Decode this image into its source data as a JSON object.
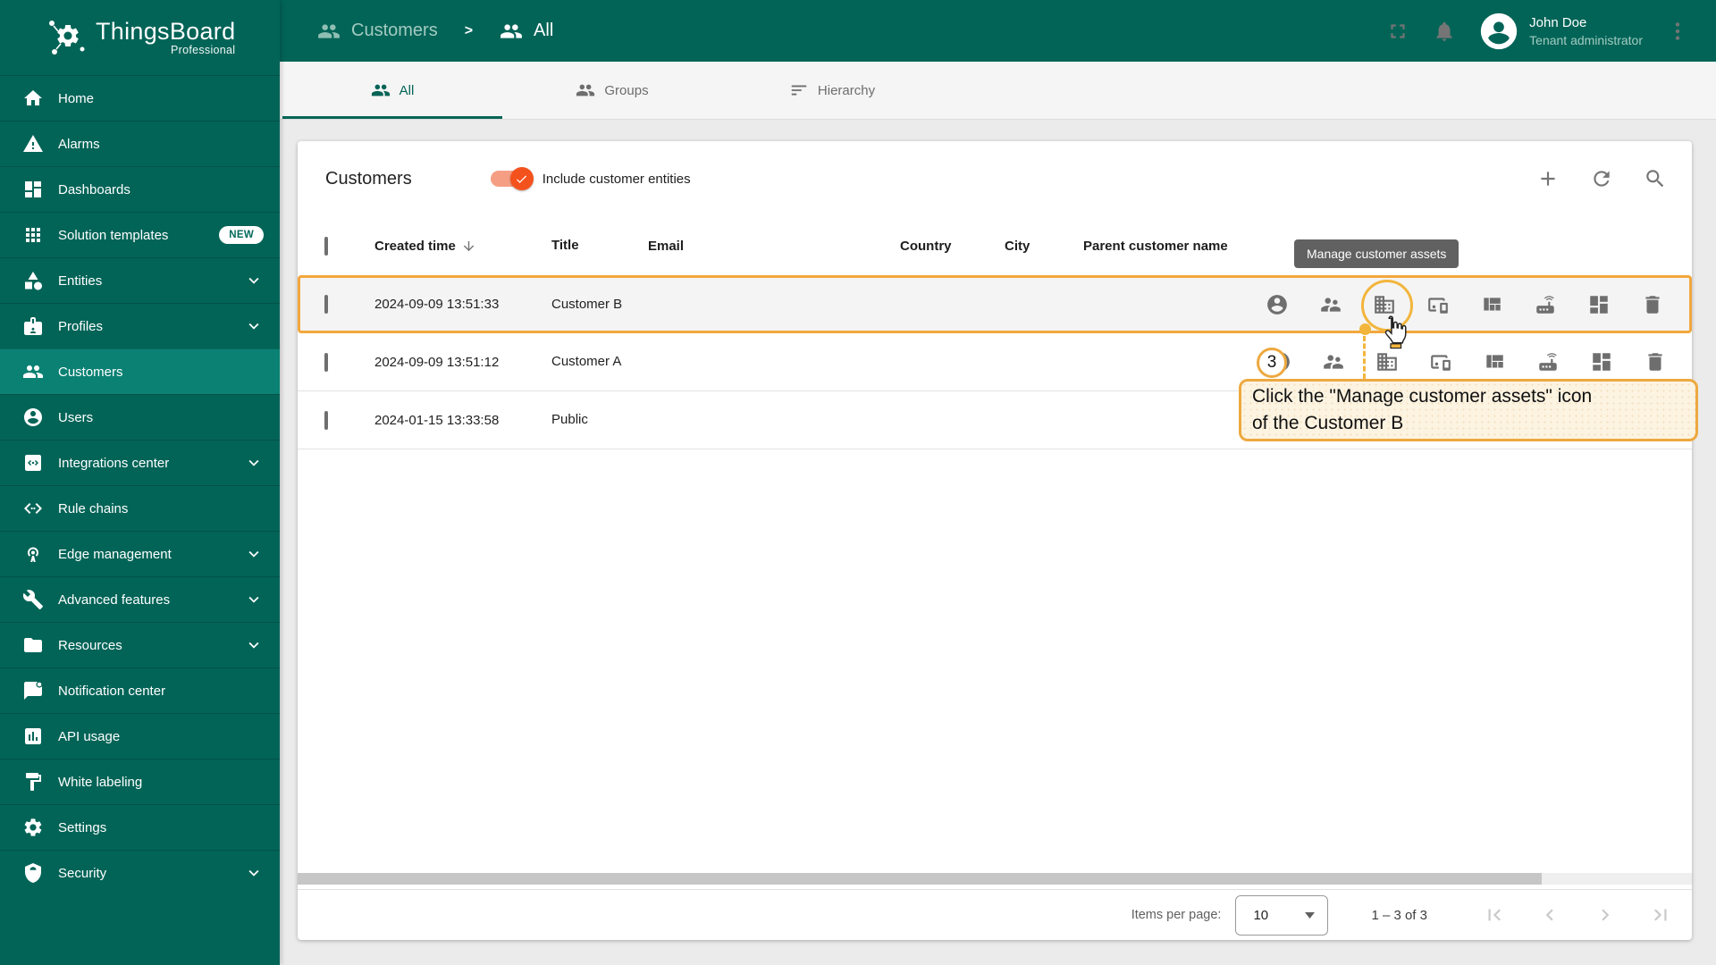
{
  "app": {
    "name": "ThingsBoard",
    "edition": "Professional"
  },
  "topbar": {
    "breadcrumb": {
      "parent": "Customers",
      "current": "All"
    },
    "user": {
      "name": "John Doe",
      "role": "Tenant administrator"
    }
  },
  "sidebar": {
    "items": [
      {
        "label": "Home",
        "icon": "home-icon"
      },
      {
        "label": "Alarms",
        "icon": "warning-icon"
      },
      {
        "label": "Dashboards",
        "icon": "dashboard-icon"
      },
      {
        "label": "Solution templates",
        "icon": "apps-grid-icon",
        "badge": "NEW"
      },
      {
        "label": "Entities",
        "icon": "category-icon",
        "expandable": true
      },
      {
        "label": "Profiles",
        "icon": "badge-icon",
        "expandable": true
      },
      {
        "label": "Customers",
        "icon": "people-icon",
        "selected": true
      },
      {
        "label": "Users",
        "icon": "account-circle-icon"
      },
      {
        "label": "Integrations center",
        "icon": "integration-icon",
        "expandable": true
      },
      {
        "label": "Rule chains",
        "icon": "code-icon"
      },
      {
        "label": "Edge management",
        "icon": "antenna-icon",
        "expandable": true
      },
      {
        "label": "Advanced features",
        "icon": "wrench-icon",
        "expandable": true
      },
      {
        "label": "Resources",
        "icon": "folder-icon",
        "expandable": true
      },
      {
        "label": "Notification center",
        "icon": "notification-icon"
      },
      {
        "label": "API usage",
        "icon": "chart-box-icon"
      },
      {
        "label": "White labeling",
        "icon": "paint-roller-icon"
      },
      {
        "label": "Settings",
        "icon": "gear-icon"
      },
      {
        "label": "Security",
        "icon": "shield-icon",
        "expandable": true
      }
    ]
  },
  "tabs": [
    {
      "label": "All",
      "active": true
    },
    {
      "label": "Groups",
      "active": false
    },
    {
      "label": "Hierarchy",
      "active": false
    }
  ],
  "panel": {
    "title": "Customers",
    "toggle_label": "Include customer entities",
    "toggle_on": true
  },
  "table": {
    "columns": {
      "created": "Created time",
      "title": "Title",
      "email": "Email",
      "country": "Country",
      "city": "City",
      "parent": "Parent customer name"
    },
    "sorted_by": "Created time",
    "rows": [
      {
        "created": "2024-09-09 13:51:33",
        "title": "Customer B",
        "email": "",
        "country": "",
        "city": "",
        "parent": ""
      },
      {
        "created": "2024-09-09 13:51:12",
        "title": "Customer A",
        "email": "",
        "country": "",
        "city": "",
        "parent": ""
      },
      {
        "created": "2024-01-15 13:33:58",
        "title": "Public",
        "email": "",
        "country": "",
        "city": "",
        "parent": ""
      }
    ],
    "row_action_icons": [
      "account-circle",
      "supervisor-account",
      "domain-building",
      "devices-other",
      "view-quilt",
      "router",
      "dashboard-tiles",
      "delete"
    ]
  },
  "tooltip": {
    "text": "Manage customer assets"
  },
  "annotation": {
    "step": "3",
    "line1": "Click the \"Manage customer assets\" icon",
    "line2": "of the Customer B"
  },
  "pagination": {
    "items_per_page_label": "Items per page:",
    "items_per_page_value": "10",
    "range_label": "1 – 3 of 3"
  },
  "colors": {
    "primary_teal": "#026457",
    "sidebar_selected": "#0a8173",
    "toggle_orange": "#f4521d",
    "highlight_orange": "#f2a73d",
    "annotation_border": "#eda93f",
    "annotation_bg": "#fcf3e1",
    "tooltip_bg": "#616161"
  }
}
